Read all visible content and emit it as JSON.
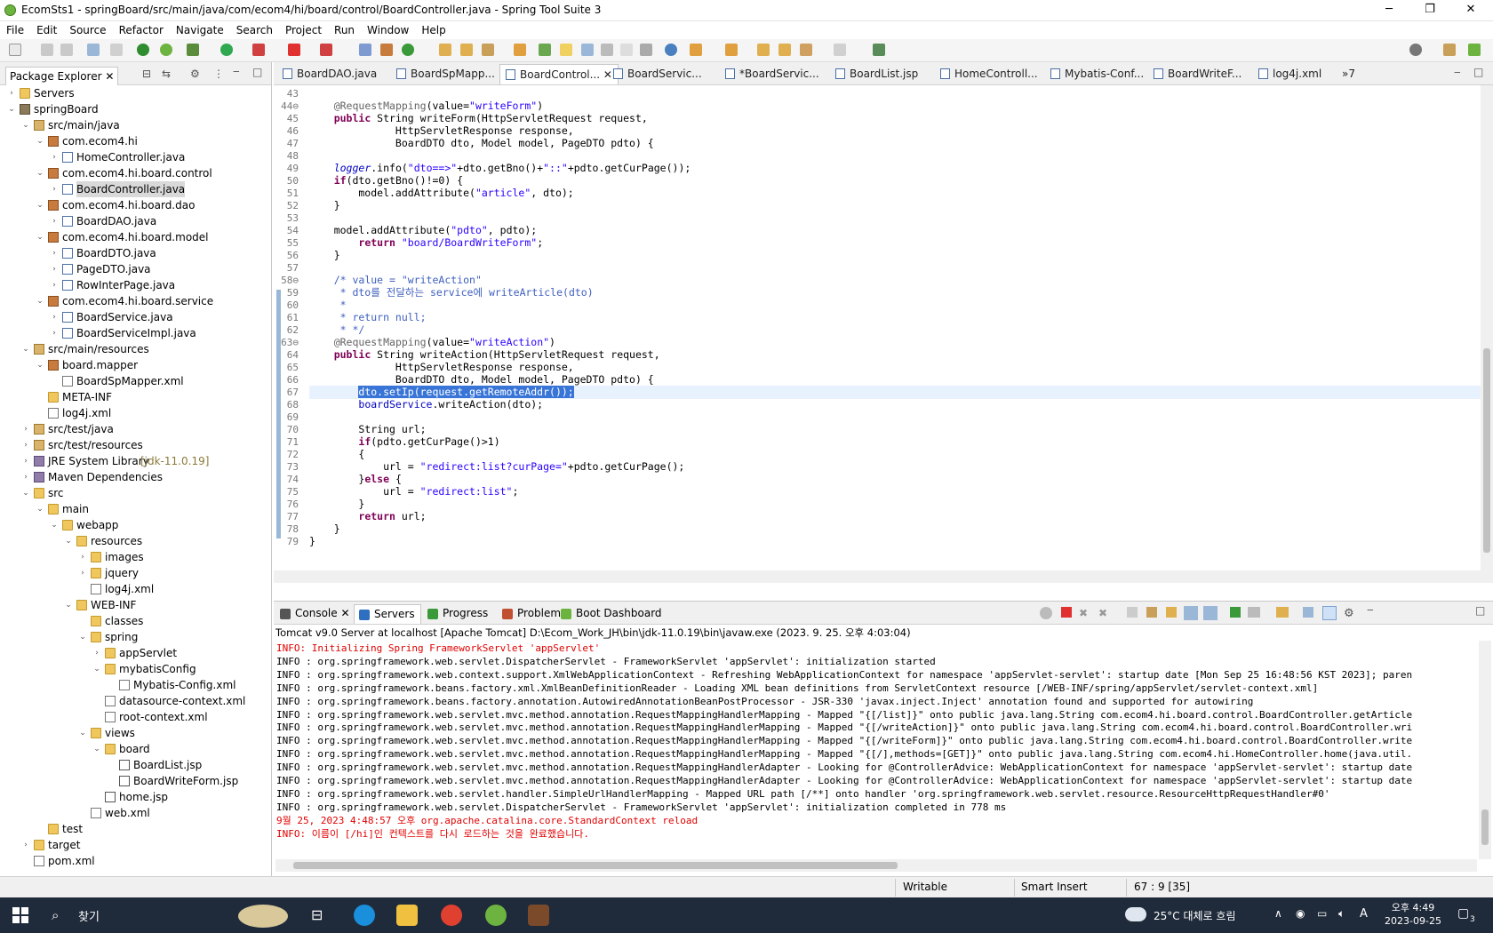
{
  "window": {
    "title": "EcomSts1 - springBoard/src/main/java/com/ecom4/hi/board/control/BoardController.java - Spring Tool Suite 3",
    "minimize": "─",
    "maximize": "❐",
    "close": "✕"
  },
  "menu": [
    "File",
    "Edit",
    "Source",
    "Refactor",
    "Navigate",
    "Search",
    "Project",
    "Run",
    "Window",
    "Help"
  ],
  "explorer": {
    "tab_label": "Package Explorer",
    "tree": [
      {
        "label": "Servers",
        "depth": 0,
        "icon": "folder-icon",
        "arrow": "›"
      },
      {
        "label": "springBoard",
        "depth": 0,
        "icon": "project-icon",
        "arrow": "⌄"
      },
      {
        "label": "src/main/java",
        "depth": 1,
        "icon": "source-folder-icon",
        "arrow": "⌄"
      },
      {
        "label": "com.ecom4.hi",
        "depth": 2,
        "icon": "package-icon",
        "arrow": "⌄"
      },
      {
        "label": "HomeController.java",
        "depth": 3,
        "icon": "java-file-icon",
        "arrow": "›"
      },
      {
        "label": "com.ecom4.hi.board.control",
        "depth": 2,
        "icon": "package-icon",
        "arrow": "⌄"
      },
      {
        "label": "BoardController.java",
        "depth": 3,
        "icon": "java-file-icon",
        "arrow": "›",
        "selected": true
      },
      {
        "label": "com.ecom4.hi.board.dao",
        "depth": 2,
        "icon": "package-icon",
        "arrow": "⌄"
      },
      {
        "label": "BoardDAO.java",
        "depth": 3,
        "icon": "java-file-icon",
        "arrow": "›"
      },
      {
        "label": "com.ecom4.hi.board.model",
        "depth": 2,
        "icon": "package-icon",
        "arrow": "⌄"
      },
      {
        "label": "BoardDTO.java",
        "depth": 3,
        "icon": "java-file-icon",
        "arrow": "›"
      },
      {
        "label": "PageDTO.java",
        "depth": 3,
        "icon": "java-file-icon",
        "arrow": "›"
      },
      {
        "label": "RowInterPage.java",
        "depth": 3,
        "icon": "java-file-icon",
        "arrow": "›"
      },
      {
        "label": "com.ecom4.hi.board.service",
        "depth": 2,
        "icon": "package-icon",
        "arrow": "⌄"
      },
      {
        "label": "BoardService.java",
        "depth": 3,
        "icon": "java-file-icon",
        "arrow": "›"
      },
      {
        "label": "BoardServiceImpl.java",
        "depth": 3,
        "icon": "java-file-icon",
        "arrow": "›"
      },
      {
        "label": "src/main/resources",
        "depth": 1,
        "icon": "source-folder-icon",
        "arrow": "⌄"
      },
      {
        "label": "board.mapper",
        "depth": 2,
        "icon": "package-icon",
        "arrow": "⌄"
      },
      {
        "label": "BoardSpMapper.xml",
        "depth": 3,
        "icon": "xml-file-icon",
        "arrow": ""
      },
      {
        "label": "META-INF",
        "depth": 2,
        "icon": "folder-icon",
        "arrow": ""
      },
      {
        "label": "log4j.xml",
        "depth": 2,
        "icon": "xml-file-icon",
        "arrow": ""
      },
      {
        "label": "src/test/java",
        "depth": 1,
        "icon": "source-folder-icon",
        "arrow": "›"
      },
      {
        "label": "src/test/resources",
        "depth": 1,
        "icon": "source-folder-icon",
        "arrow": "›"
      },
      {
        "label": "JRE System Library",
        "suffix": "[jdk-11.0.19]",
        "depth": 1,
        "icon": "library-icon",
        "arrow": "›"
      },
      {
        "label": "Maven Dependencies",
        "depth": 1,
        "icon": "library-icon",
        "arrow": "›"
      },
      {
        "label": "src",
        "depth": 1,
        "icon": "folder-icon",
        "arrow": "⌄"
      },
      {
        "label": "main",
        "depth": 2,
        "icon": "folder-icon",
        "arrow": "⌄"
      },
      {
        "label": "webapp",
        "depth": 3,
        "icon": "folder-icon",
        "arrow": "⌄"
      },
      {
        "label": "resources",
        "depth": 4,
        "icon": "folder-icon",
        "arrow": "⌄"
      },
      {
        "label": "images",
        "depth": 5,
        "icon": "folder-icon",
        "arrow": "›"
      },
      {
        "label": "jquery",
        "depth": 5,
        "icon": "folder-icon",
        "arrow": "›"
      },
      {
        "label": "log4j.xml",
        "depth": 5,
        "icon": "xml-file-icon",
        "arrow": ""
      },
      {
        "label": "WEB-INF",
        "depth": 4,
        "icon": "folder-icon",
        "arrow": "⌄"
      },
      {
        "label": "classes",
        "depth": 5,
        "icon": "folder-icon",
        "arrow": ""
      },
      {
        "label": "spring",
        "depth": 5,
        "icon": "folder-icon",
        "arrow": "⌄"
      },
      {
        "label": "appServlet",
        "depth": 6,
        "icon": "folder-icon",
        "arrow": "›"
      },
      {
        "label": "mybatisConfig",
        "depth": 6,
        "icon": "folder-icon",
        "arrow": "⌄"
      },
      {
        "label": "Mybatis-Config.xml",
        "depth": 7,
        "icon": "xml-file-icon",
        "arrow": ""
      },
      {
        "label": "datasource-context.xml",
        "depth": 6,
        "icon": "xml-file-icon",
        "arrow": ""
      },
      {
        "label": "root-context.xml",
        "depth": 6,
        "icon": "xml-file-icon",
        "arrow": ""
      },
      {
        "label": "views",
        "depth": 5,
        "icon": "folder-icon",
        "arrow": "⌄"
      },
      {
        "label": "board",
        "depth": 6,
        "icon": "folder-icon",
        "arrow": "⌄"
      },
      {
        "label": "BoardList.jsp",
        "depth": 7,
        "icon": "jsp-file-icon",
        "arrow": ""
      },
      {
        "label": "BoardWriteForm.jsp",
        "depth": 7,
        "icon": "jsp-file-icon",
        "arrow": ""
      },
      {
        "label": "home.jsp",
        "depth": 6,
        "icon": "jsp-file-icon",
        "arrow": ""
      },
      {
        "label": "web.xml",
        "depth": 5,
        "icon": "xml-file-icon",
        "arrow": ""
      },
      {
        "label": "test",
        "depth": 2,
        "icon": "folder-icon",
        "arrow": ""
      },
      {
        "label": "target",
        "depth": 1,
        "icon": "folder-icon",
        "arrow": "›"
      },
      {
        "label": "pom.xml",
        "depth": 1,
        "icon": "xml-file-icon",
        "arrow": ""
      }
    ]
  },
  "editor_tabs": [
    {
      "label": "BoardDAO.java"
    },
    {
      "label": "BoardSpMapp..."
    },
    {
      "label": "BoardControl...",
      "active": true
    },
    {
      "label": "BoardServic..."
    },
    {
      "label": "*BoardServic..."
    },
    {
      "label": "BoardList.jsp"
    },
    {
      "label": "HomeControll..."
    },
    {
      "label": "Mybatis-Conf..."
    },
    {
      "label": "BoardWriteF..."
    },
    {
      "label": "log4j.xml"
    },
    {
      "label": "»7"
    }
  ],
  "code_lines": [
    {
      "n": "43",
      "html": ""
    },
    {
      "n": "44⊖",
      "html": "    <span class='an'>@RequestMapping</span>(value=<span class='st'>\"writeForm\"</span>)"
    },
    {
      "n": "45",
      "html": "    <span class='kw'>public</span> String writeForm(HttpServletRequest request,"
    },
    {
      "n": "46",
      "html": "              HttpServletResponse response,"
    },
    {
      "n": "47",
      "html": "              BoardDTO dto, Model model, PageDTO pdto) {"
    },
    {
      "n": "48",
      "html": ""
    },
    {
      "n": "49",
      "html": "    <span class='it'>logger</span>.info(<span class='st'>\"dto==>\"</span>+dto.getBno()+<span class='st'>\"::\"</span>+pdto.getCurPage());"
    },
    {
      "n": "50",
      "html": "    <span class='kw'>if</span>(dto.getBno()!=0) {"
    },
    {
      "n": "51",
      "html": "        model.addAttribute(<span class='st'>\"article\"</span>, dto);"
    },
    {
      "n": "52",
      "html": "    }"
    },
    {
      "n": "53",
      "html": ""
    },
    {
      "n": "54",
      "html": "    model.addAttribute(<span class='st'>\"pdto\"</span>, pdto);"
    },
    {
      "n": "55",
      "html": "        <span class='kw'>return</span> <span class='st'>\"board/BoardWriteForm\"</span>;"
    },
    {
      "n": "56",
      "html": "    }"
    },
    {
      "n": "57",
      "html": ""
    },
    {
      "n": "58⊖",
      "html": "    <span class='cm'>/* value = \"writeAction\"</span>"
    },
    {
      "n": "59",
      "html": "<span class='cm'>     * dto를 전달하는 service에 writeArticle(dto)</span>"
    },
    {
      "n": "60",
      "html": "<span class='cm'>     *</span>"
    },
    {
      "n": "61",
      "html": "<span class='cm'>     * return null;</span>"
    },
    {
      "n": "62",
      "html": "<span class='cm'>     * */</span>"
    },
    {
      "n": "63⊖",
      "html": "    <span class='an'>@RequestMapping</span>(value=<span class='st'>\"writeAction\"</span>)"
    },
    {
      "n": "64",
      "html": "    <span class='kw'>public</span> String writeAction(HttpServletRequest request,"
    },
    {
      "n": "65",
      "html": "              HttpServletResponse response,"
    },
    {
      "n": "66",
      "html": "              BoardDTO dto, Model model, PageDTO pdto) {"
    },
    {
      "n": "67",
      "html": "        <span class='hl'>dto.setIp(request.getRemoteAddr());</span>",
      "current": true
    },
    {
      "n": "68",
      "html": "        <span class='fd'>boardService</span>.writeAction(dto);"
    },
    {
      "n": "69",
      "html": ""
    },
    {
      "n": "70",
      "html": "        String url;"
    },
    {
      "n": "71",
      "html": "        <span class='kw'>if</span>(pdto.getCurPage()>1)"
    },
    {
      "n": "72",
      "html": "        {"
    },
    {
      "n": "73",
      "html": "            url = <span class='st'>\"redirect:list?curPage=\"</span>+pdto.getCurPage();"
    },
    {
      "n": "74",
      "html": "        }<span class='kw'>else</span> {"
    },
    {
      "n": "75",
      "html": "            url = <span class='st'>\"redirect:list\"</span>;"
    },
    {
      "n": "76",
      "html": "        }"
    },
    {
      "n": "77",
      "html": "        <span class='kw'>return</span> url;"
    },
    {
      "n": "78",
      "html": "    }"
    },
    {
      "n": "79",
      "html": "}"
    }
  ],
  "console": {
    "tabs": [
      {
        "label": "Console",
        "icon": "console-icon"
      },
      {
        "label": "Servers",
        "icon": "servers-icon",
        "active": true
      },
      {
        "label": "Progress",
        "icon": "progress-icon"
      },
      {
        "label": "Problems",
        "icon": "problems-icon"
      },
      {
        "label": "Boot Dashboard",
        "icon": "boot-dashboard-icon"
      }
    ],
    "header": "Tomcat v9.0 Server at localhost [Apache Tomcat] D:\\Ecom_Work_JH\\bin\\jdk-11.0.19\\bin\\javaw.exe  (2023. 9. 25. 오후 4:03:04)",
    "lines": [
      {
        "text": "INFO: Initializing Spring FrameworkServlet 'appServlet'",
        "red": true
      },
      {
        "text": "INFO : org.springframework.web.servlet.DispatcherServlet - FrameworkServlet 'appServlet': initialization started"
      },
      {
        "text": "INFO : org.springframework.web.context.support.XmlWebApplicationContext - Refreshing WebApplicationContext for namespace 'appServlet-servlet': startup date [Mon Sep 25 16:48:56 KST 2023]; paren"
      },
      {
        "text": "INFO : org.springframework.beans.factory.xml.XmlBeanDefinitionReader - Loading XML bean definitions from ServletContext resource [/WEB-INF/spring/appServlet/servlet-context.xml]"
      },
      {
        "text": "INFO : org.springframework.beans.factory.annotation.AutowiredAnnotationBeanPostProcessor - JSR-330 'javax.inject.Inject' annotation found and supported for autowiring"
      },
      {
        "text": "INFO : org.springframework.web.servlet.mvc.method.annotation.RequestMappingHandlerMapping - Mapped \"{[/list]}\" onto public java.lang.String com.ecom4.hi.board.control.BoardController.getArticle"
      },
      {
        "text": "INFO : org.springframework.web.servlet.mvc.method.annotation.RequestMappingHandlerMapping - Mapped \"{[/writeAction]}\" onto public java.lang.String com.ecom4.hi.board.control.BoardController.wri"
      },
      {
        "text": "INFO : org.springframework.web.servlet.mvc.method.annotation.RequestMappingHandlerMapping - Mapped \"{[/writeForm]}\" onto public java.lang.String com.ecom4.hi.board.control.BoardController.write"
      },
      {
        "text": "INFO : org.springframework.web.servlet.mvc.method.annotation.RequestMappingHandlerMapping - Mapped \"{[/],methods=[GET]}\" onto public java.lang.String com.ecom4.hi.HomeController.home(java.util."
      },
      {
        "text": "INFO : org.springframework.web.servlet.mvc.method.annotation.RequestMappingHandlerAdapter - Looking for @ControllerAdvice: WebApplicationContext for namespace 'appServlet-servlet': startup date"
      },
      {
        "text": "INFO : org.springframework.web.servlet.mvc.method.annotation.RequestMappingHandlerAdapter - Looking for @ControllerAdvice: WebApplicationContext for namespace 'appServlet-servlet': startup date"
      },
      {
        "text": "INFO : org.springframework.web.servlet.handler.SimpleUrlHandlerMapping - Mapped URL path [/**] onto handler 'org.springframework.web.servlet.resource.ResourceHttpRequestHandler#0'"
      },
      {
        "text": "INFO : org.springframework.web.servlet.DispatcherServlet - FrameworkServlet 'appServlet': initialization completed in 778 ms"
      },
      {
        "text": "9월 25, 2023 4:48:57 오후 org.apache.catalina.core.StandardContext reload",
        "red": true
      },
      {
        "text": "INFO: 이름이 [/hi]인 컨텍스트를 다시 로드하는 것을 완료했습니다.",
        "red": true
      }
    ]
  },
  "status": {
    "writable": "Writable",
    "insert_mode": "Smart Insert",
    "cursor": "67 : 9 [35]"
  },
  "taskbar": {
    "search_label": "찾기",
    "weather": "25°C  대체로 흐림",
    "time": "오후 4:49",
    "date": "2023-09-25",
    "notification_count": "3",
    "ime": "A"
  },
  "colors": {
    "accent": "#3875d7",
    "keyword": "#7f0055",
    "string": "#2a00ff",
    "comment": "#3f5fbf",
    "console_error": "#e00000"
  }
}
